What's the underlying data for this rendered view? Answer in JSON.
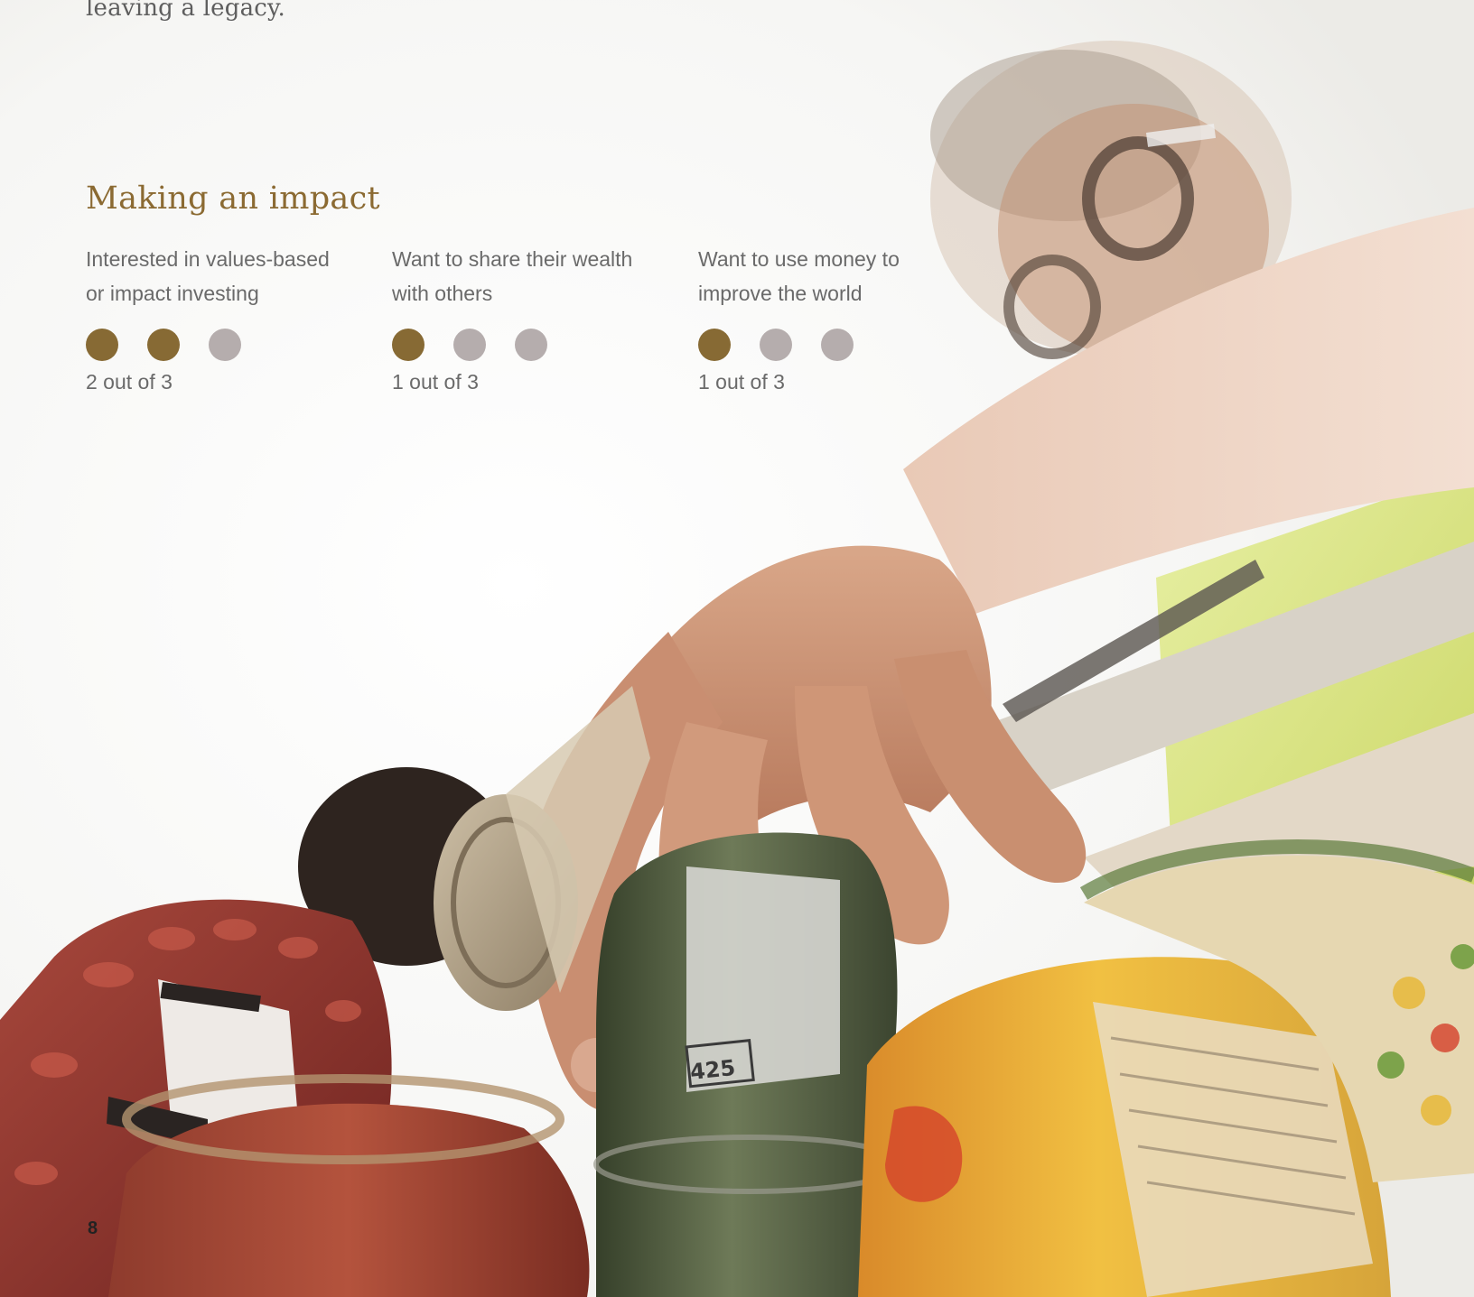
{
  "intro": {
    "tail_text": "leaving a legacy."
  },
  "section": {
    "title": "Making an impact"
  },
  "stats": [
    {
      "description": [
        "Interested in values-based",
        "or impact investing"
      ],
      "filled": 2,
      "total": 3,
      "value_text": "2 out of 3"
    },
    {
      "description": [
        "Want to share their wealth",
        "with others"
      ],
      "filled": 1,
      "total": 3,
      "value_text": "1 out of 3"
    },
    {
      "description": [
        "Want to use money to",
        "improve the world"
      ],
      "filled": 1,
      "total": 3,
      "value_text": "1 out of 3"
    }
  ],
  "colors": {
    "accent": "#8b6a32",
    "dot_filled": "#876a34",
    "dot_empty": "#b5adad",
    "body_text": "#6a6a6a"
  },
  "photo": {
    "subject": "hand-reaching-into-box-of-canned-food-photo"
  },
  "page": {
    "number": "8"
  }
}
